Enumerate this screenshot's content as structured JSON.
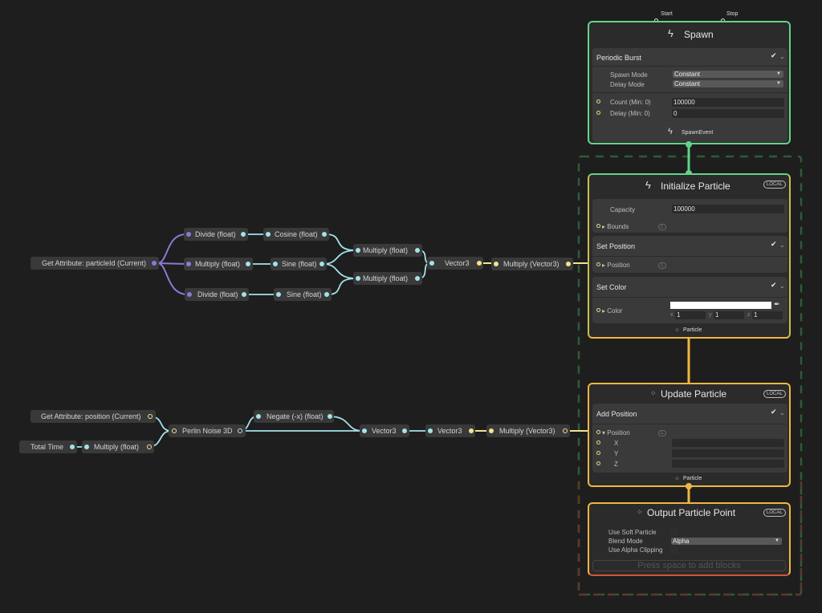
{
  "colors": {
    "background": "#1e1e1e",
    "spawn_border": "#62d488",
    "particle_border": "#f1b641",
    "output_border_bottom": "#d0553b",
    "float_wire": "#a4e2ea",
    "uint_wire": "#8e78d6",
    "vector3_wire": "#f3e392"
  },
  "operators": {
    "get_particle_id": "Get Attribute: particleId (Current)",
    "divide_1": "Divide (float)",
    "cosine": "Cosine (float)",
    "multiply_1": "Multiply (float)",
    "sine_1": "Sine (float)",
    "divide_2": "Divide (float)",
    "sine_2": "Sine (float)",
    "multiply_top": "Multiply (float)",
    "multiply_bottom": "Multiply (float)",
    "vector3_top": "Vector3",
    "multiply_vector3_top": "Multiply (Vector3)",
    "get_position": "Get Attribute: position (Current)",
    "total_time": "Total Time",
    "multiply_time": "Multiply (float)",
    "perlin": "Perlin Noise 3D",
    "negate": "Negate (-x) (float)",
    "vector3_b1": "Vector3",
    "vector3_b2": "Vector3",
    "multiply_vector3_bottom": "Multiply (Vector3)"
  },
  "spawn": {
    "start": "Start",
    "stop": "Stop",
    "title": "Spawn",
    "block_title": "Periodic Burst",
    "spawn_mode_label": "Spawn Mode",
    "spawn_mode_value": "Constant",
    "delay_mode_label": "Delay Mode",
    "delay_mode_value": "Constant",
    "count_label": "Count (Min: 0)",
    "count_value": "100000",
    "delay_label": "Delay (Min: 0)",
    "delay_value": "0",
    "event": "SpawnEvent"
  },
  "initialize": {
    "title": "Initialize Particle",
    "badge": "LOCAL",
    "capacity_label": "Capacity",
    "capacity_value": "100000",
    "bounds_label": "Bounds",
    "set_position": "Set Position",
    "position_label": "Position",
    "set_color": "Set Color",
    "color_label": "Color",
    "color_value": "#ffffff",
    "x_label": "x",
    "x_value": "1",
    "y_label": "y",
    "y_value": "1",
    "z_label": "z",
    "z_value": "1",
    "footer": "Particle"
  },
  "update": {
    "title": "Update Particle",
    "badge": "LOCAL",
    "block_title": "Add Position",
    "position_label": "Position",
    "x_label": "X",
    "y_label": "Y",
    "z_label": "Z",
    "footer": "Particle"
  },
  "output": {
    "title": "Output Particle Point",
    "badge": "LOCAL",
    "soft_particle_label": "Use Soft Particle",
    "blend_mode_label": "Blend Mode",
    "blend_mode_value": "Alpha",
    "alpha_clipping_label": "Use Alpha Clipping",
    "hint": "Press space to add blocks"
  }
}
